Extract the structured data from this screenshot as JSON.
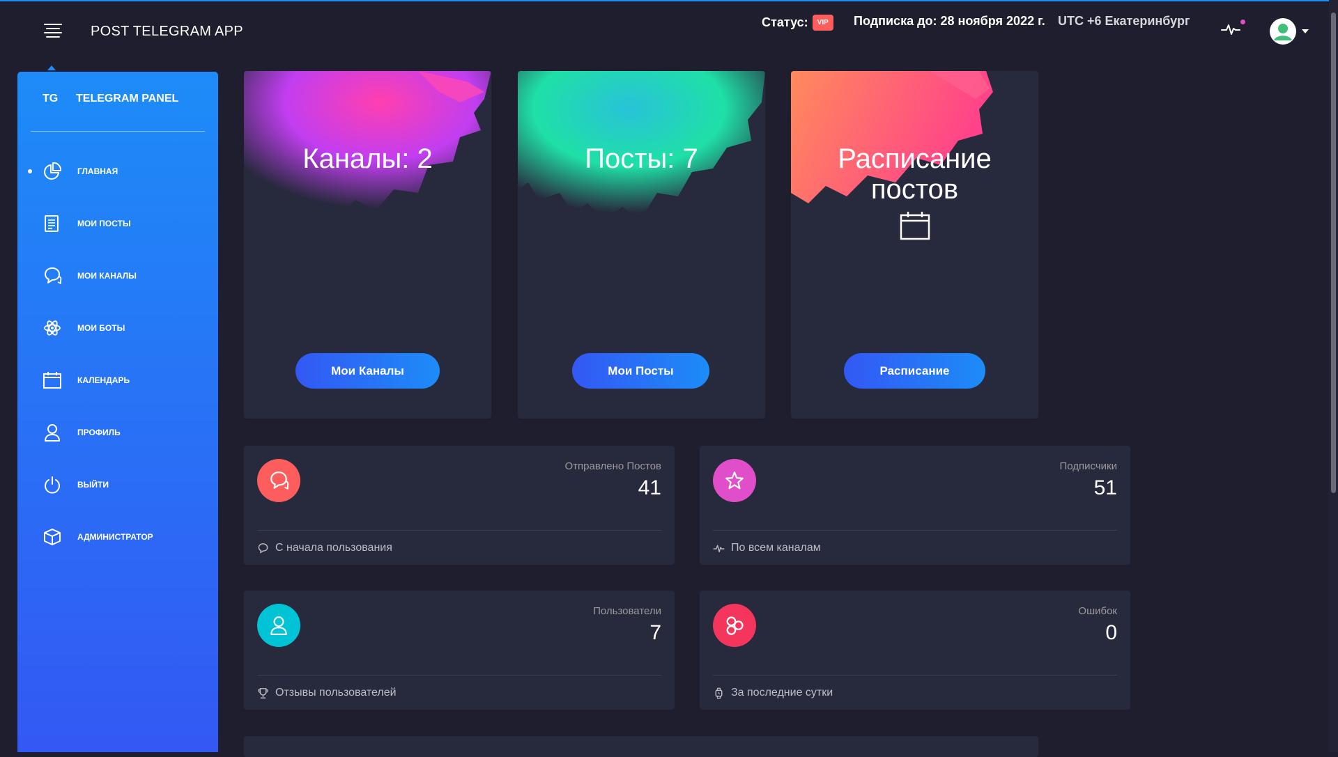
{
  "navbar": {
    "brand": "POST TELEGRAM APP",
    "status_label": "Статус:",
    "status_badge": "VIP",
    "subscription": "Подписка до: 28 ноября 2022 г.",
    "timezone": "UTC +6 Екатеринбург"
  },
  "sidebar": {
    "logo_mini": "TG",
    "logo_text": "TELEGRAM PANEL",
    "items": [
      {
        "label": "Главная",
        "icon": "chart-pie-icon",
        "active": true
      },
      {
        "label": "Мои посты",
        "icon": "paper-icon"
      },
      {
        "label": "Мои каналы",
        "icon": "chat-bubbles-icon"
      },
      {
        "label": "Мои боты",
        "icon": "atom-icon"
      },
      {
        "label": "Календарь",
        "icon": "calendar-icon"
      },
      {
        "label": "Профиль",
        "icon": "user-icon"
      },
      {
        "label": "Выйти",
        "icon": "power-icon"
      },
      {
        "label": "Администратор",
        "icon": "cube-icon"
      }
    ]
  },
  "cards": [
    {
      "title": "Каналы: 2",
      "button": "Мои Каналы",
      "splash_colors": [
        "#c13ef0",
        "#ff3fb0"
      ]
    },
    {
      "title": "Посты: 7",
      "button": "Мои Посты",
      "splash_colors": [
        "#1fe0a6",
        "#28c3d8"
      ]
    },
    {
      "title_line1": "Расписание",
      "title_line2": "постов",
      "button": "Расписание",
      "icon": "calendar-icon",
      "splash_colors": [
        "#ff8a5c",
        "#ff3f8c"
      ]
    }
  ],
  "stats": [
    {
      "label": "Отправлено Постов",
      "value": "41",
      "footer": "С начала пользования",
      "icon": "chat-bubbles-icon",
      "footer_icon": "chat-icon",
      "color": "#fd5d5d"
    },
    {
      "label": "Подписчики",
      "value": "51",
      "footer": "По всем каналам",
      "icon": "star-icon",
      "footer_icon": "pulse-icon",
      "color": "#e14eca"
    },
    {
      "label": "Пользователи",
      "value": "7",
      "footer": "Отзывы пользователей",
      "icon": "user-icon",
      "footer_icon": "trophy-icon",
      "color": "#00c4d6"
    },
    {
      "label": "Ошибок",
      "value": "0",
      "footer": "За последние сутки",
      "icon": "molecule-icon",
      "footer_icon": "watch-icon",
      "color": "#f5365c"
    }
  ]
}
